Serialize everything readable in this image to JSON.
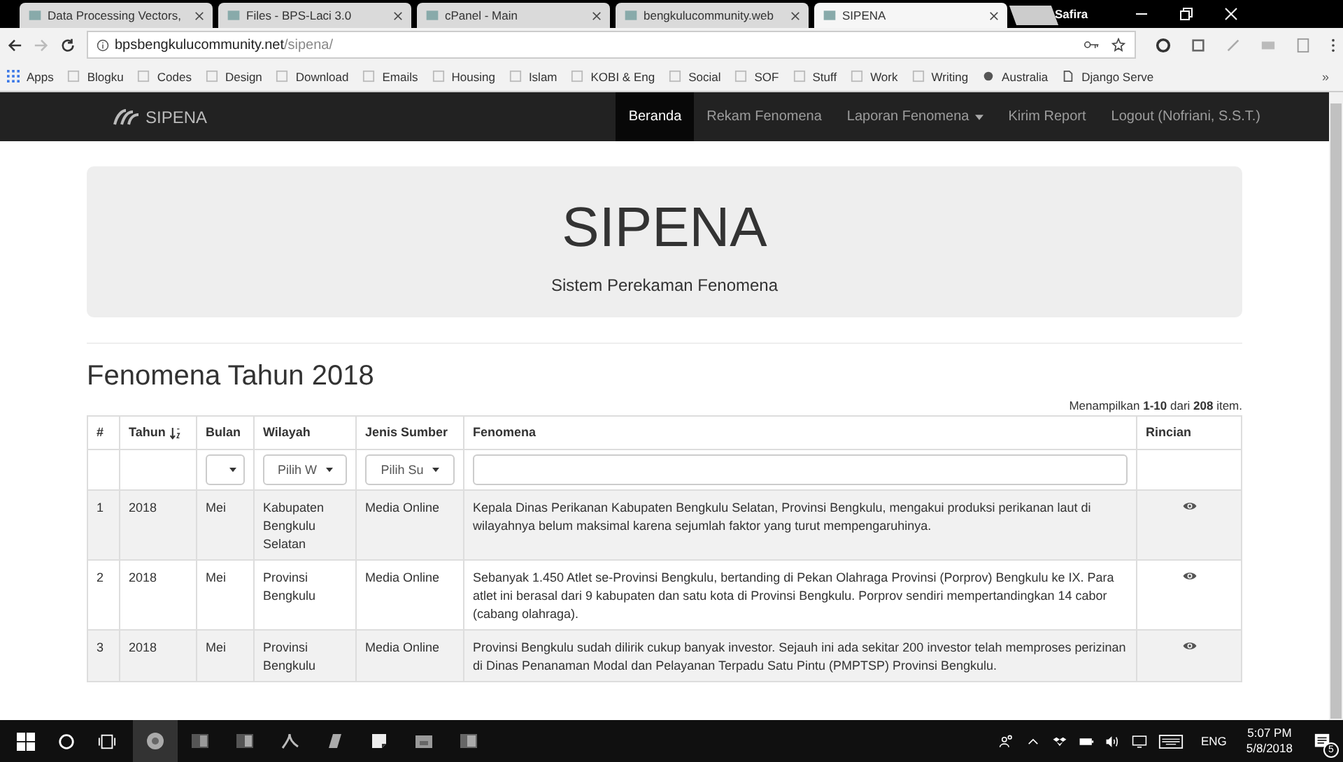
{
  "browser": {
    "tabs": [
      {
        "title": "Data Processing Vectors,",
        "selected": false
      },
      {
        "title": "Files - BPS-Laci 3.0",
        "selected": false
      },
      {
        "title": "cPanel - Main",
        "selected": false
      },
      {
        "title": "bengkulucommunity.web",
        "selected": false
      },
      {
        "title": "SIPENA",
        "selected": true
      }
    ],
    "profile": "Safira",
    "address_host": "bpsbengkulucommunity.net",
    "address_path": "/sipena/",
    "bookmarks": [
      {
        "label": "Apps",
        "kind": "apps"
      },
      {
        "label": "Blogku",
        "kind": "folder"
      },
      {
        "label": "Codes",
        "kind": "folder"
      },
      {
        "label": "Design",
        "kind": "folder"
      },
      {
        "label": "Download",
        "kind": "folder"
      },
      {
        "label": "Emails",
        "kind": "folder"
      },
      {
        "label": "Housing",
        "kind": "folder"
      },
      {
        "label": "Islam",
        "kind": "folder"
      },
      {
        "label": "KOBI & Eng",
        "kind": "folder"
      },
      {
        "label": "Social",
        "kind": "folder"
      },
      {
        "label": "SOF",
        "kind": "folder"
      },
      {
        "label": "Stuff",
        "kind": "folder"
      },
      {
        "label": "Work",
        "kind": "folder"
      },
      {
        "label": "Writing",
        "kind": "folder"
      },
      {
        "label": "Australia",
        "kind": "site"
      },
      {
        "label": "Django Serve",
        "kind": "page"
      }
    ],
    "more": "»"
  },
  "navbar": {
    "brand": "SIPENA",
    "items": [
      {
        "label": "Beranda",
        "selected": true,
        "dropdown": false
      },
      {
        "label": "Rekam Fenomena",
        "selected": false,
        "dropdown": false
      },
      {
        "label": "Laporan Fenomena",
        "selected": false,
        "dropdown": true
      },
      {
        "label": "Kirim Report",
        "selected": false,
        "dropdown": false
      },
      {
        "label": "Logout (Nofriani, S.S.T.)",
        "selected": false,
        "dropdown": false
      }
    ]
  },
  "jumbotron": {
    "title": "SIPENA",
    "subtitle": "Sistem Perekaman Fenomena"
  },
  "heading": "Fenomena Tahun 2018",
  "summary": "Menampilkan **1-10** dari **208** item.",
  "table": {
    "columns": [
      "#",
      "Tahun",
      "Bulan",
      "Wilayah",
      "Jenis Sumber",
      "Fenomena",
      "Rincian"
    ],
    "filters": {
      "wilayah": "Pilih W",
      "sumber": "Pilih Su"
    },
    "rows": [
      {
        "no": "1",
        "tahun": "2018",
        "bulan": "Mei",
        "wilayah": "Kabupaten Bengkulu Selatan",
        "sumber": "Media Online",
        "fenomena": "Kepala Dinas Perikanan Kabupaten Bengkulu Selatan, Provinsi Bengkulu, mengakui produksi perikanan laut di wilayahnya belum maksimal karena sejumlah faktor yang turut mempengaruhinya."
      },
      {
        "no": "2",
        "tahun": "2018",
        "bulan": "Mei",
        "wilayah": "Provinsi Bengkulu",
        "sumber": "Media Online",
        "fenomena": "Sebanyak 1.450 Atlet se-Provinsi Bengkulu, bertanding di Pekan Olahraga Provinsi (Porprov) Bengkulu ke IX. Para atlet ini berasal dari 9 kabupaten dan satu kota di Provinsi Bengkulu. Porprov sendiri mempertandingkan 14 cabor (cabang olahraga)."
      },
      {
        "no": "3",
        "tahun": "2018",
        "bulan": "Mei",
        "wilayah": "Provinsi Bengkulu",
        "sumber": "Media Online",
        "fenomena": "Provinsi Bengkulu sudah dilirik cukup banyak investor. Sejauh ini ada sekitar 200 investor telah memproses perizinan di Dinas Penanaman Modal dan Pelayanan Terpadu Satu Pintu (PMPTSP) Provinsi Bengkulu."
      }
    ]
  },
  "taskbar": {
    "language": "ENG",
    "time": "5:07 PM",
    "date": "5/8/2018",
    "notifications": "5"
  }
}
